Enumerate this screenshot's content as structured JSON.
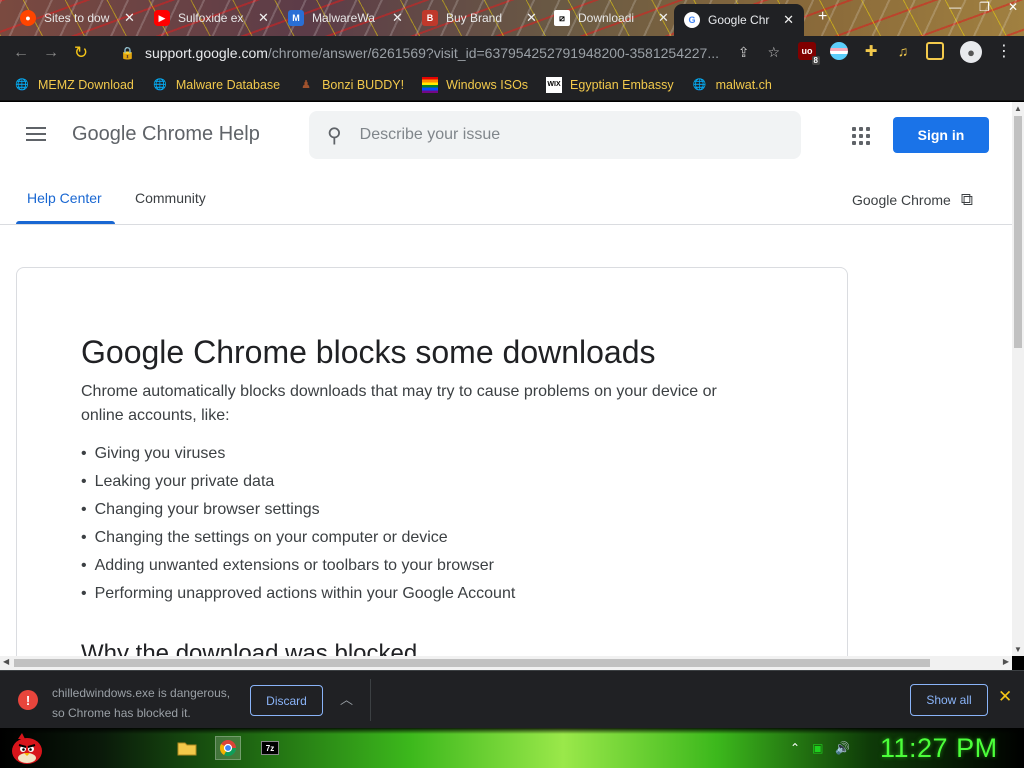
{
  "tabs": [
    {
      "title": "Sites to dow",
      "icon": "reddit-icon"
    },
    {
      "title": "Sulfoxide ex",
      "icon": "youtube-icon"
    },
    {
      "title": "MalwareWa",
      "icon": "malwarewatch-icon"
    },
    {
      "title": "Buy Brand",
      "icon": "shop-icon"
    },
    {
      "title": "Downloadi",
      "icon": "download-site-icon"
    },
    {
      "title": "Google Chr",
      "icon": "google-icon",
      "active": true
    }
  ],
  "toolbar": {
    "url_host": "support.google.com",
    "url_path": "/chrome/answer/6261569?visit_id=637954252791948200-3581254227...",
    "ext_badge": "8"
  },
  "bookmarks": [
    {
      "label": "MEMZ Download",
      "icon": "globe-icon"
    },
    {
      "label": "Malware Database",
      "icon": "globe-icon"
    },
    {
      "label": "Bonzi BUDDY!",
      "icon": "bonzi-icon"
    },
    {
      "label": "Windows ISOs",
      "icon": "windows-flag-icon"
    },
    {
      "label": "Egyptian Embassy",
      "icon": "wix-icon"
    },
    {
      "label": "malwat.ch",
      "icon": "globe-icon"
    }
  ],
  "header": {
    "brand": "Google Chrome Help",
    "search_placeholder": "Describe your issue",
    "signin": "Sign in"
  },
  "subnav": {
    "tabs": [
      "Help Center",
      "Community"
    ],
    "product": "Google Chrome"
  },
  "article": {
    "title": "Google Chrome blocks some downloads",
    "intro": "Chrome automatically blocks downloads that may try to cause problems on your device or online accounts, like:",
    "bullets": [
      "Giving you viruses",
      "Leaking your private data",
      "Changing your browser settings",
      "Changing the settings on your computer or device",
      "Adding unwanted extensions or toolbars to your browser",
      "Performing unapproved actions within your Google Account"
    ],
    "section_heading": "Why the download was blocked"
  },
  "download_shelf": {
    "line1": "chilledwindows.exe is dangerous,",
    "line2": "so Chrome has blocked it.",
    "discard": "Discard",
    "show_all": "Show all"
  },
  "taskbar": {
    "clock": "11:27 PM"
  },
  "colors": {
    "accent_blue": "#1a73e8",
    "link_blue": "#1967d2",
    "bookmark_yellow": "#f2c94c",
    "danger_red": "#e8453c",
    "clock_green": "#4cff3a"
  }
}
